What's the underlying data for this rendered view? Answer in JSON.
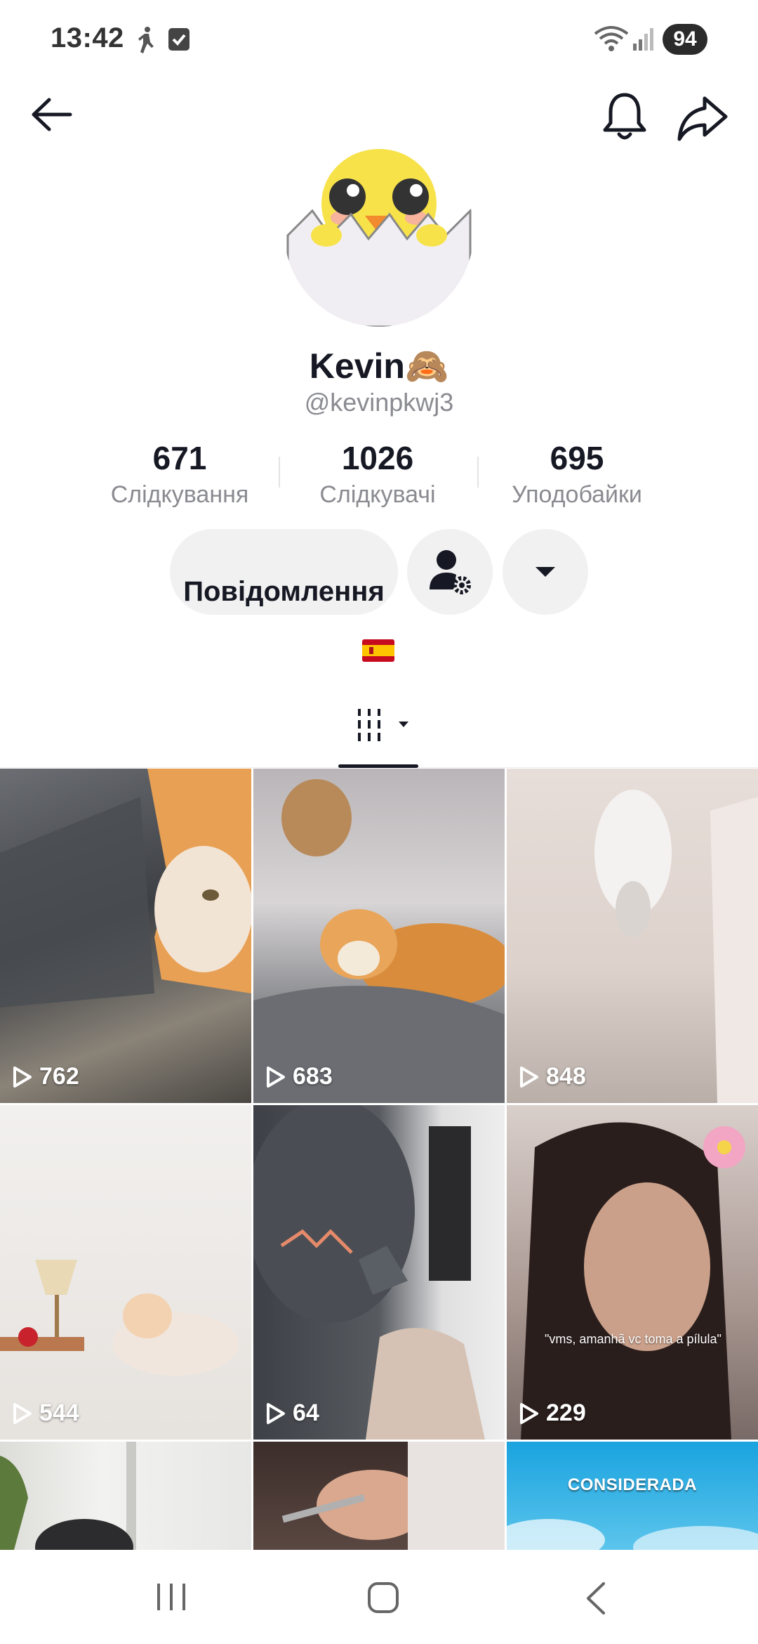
{
  "status_bar": {
    "time": "13:42",
    "battery": "94",
    "icons": [
      "walk-icon",
      "check-square-icon",
      "wifi-icon",
      "signal-icon"
    ]
  },
  "nav": {
    "back_icon": "arrow-left-icon",
    "bell_icon": "bell-icon",
    "share_icon": "share-arrow-icon"
  },
  "profile": {
    "display_name": "Kevin🙈",
    "username": "@kevinpkwj3",
    "avatar_icon": "chick-in-egg-avatar"
  },
  "stats": [
    {
      "value": "671",
      "label": "Слідкування"
    },
    {
      "value": "1026",
      "label": "Слідкувачі"
    },
    {
      "value": "695",
      "label": "Уподобайки"
    }
  ],
  "actions": {
    "message_label": "Повідомлення",
    "add_friend_icon": "person-gear-icon",
    "more_icon": "caret-down-icon"
  },
  "bio": {
    "flag": "spain-flag-icon"
  },
  "tabs": {
    "active_icon": "grid-videos-icon"
  },
  "videos": [
    {
      "views": "762",
      "overlay_text": ""
    },
    {
      "views": "683",
      "overlay_text": ""
    },
    {
      "views": "848",
      "overlay_text": ""
    },
    {
      "views": "544",
      "overlay_text": ""
    },
    {
      "views": "64",
      "overlay_text": ""
    },
    {
      "views": "229",
      "overlay_text": "\"vms, amanhã vc toma a pílula\""
    },
    {
      "views": "",
      "overlay_text": ""
    },
    {
      "views": "",
      "overlay_text": ""
    },
    {
      "views": "",
      "overlay_text": "CONSIDERADA"
    }
  ],
  "system_nav": [
    "recent-apps-icon",
    "home-icon",
    "back-icon"
  ]
}
